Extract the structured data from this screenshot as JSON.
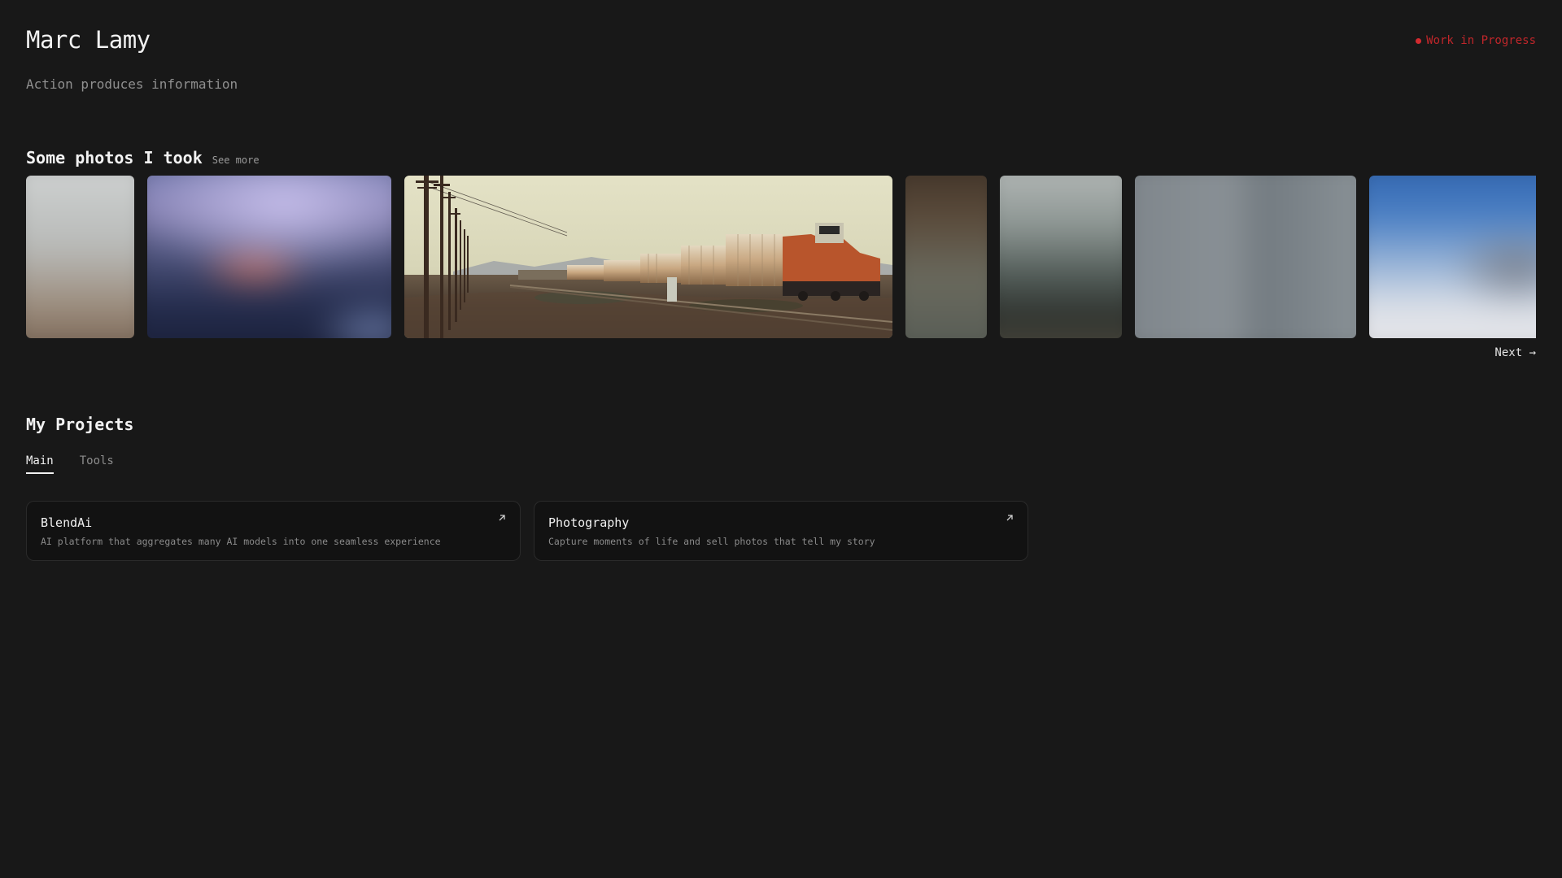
{
  "header": {
    "name": "Marc Lamy",
    "tagline": "Action produces information",
    "status": "Work in Progress",
    "status_color": "#d22a2f"
  },
  "photos": {
    "title": "Some photos I took",
    "see_more": "See more",
    "next": "Next →",
    "items": [
      {
        "name": "photo-blurred-1"
      },
      {
        "name": "photo-blurred-2"
      },
      {
        "name": "photo-train-desert"
      },
      {
        "name": "photo-blurred-4"
      },
      {
        "name": "photo-blurred-5"
      },
      {
        "name": "photo-blurred-6"
      },
      {
        "name": "photo-blurred-7"
      }
    ]
  },
  "projects": {
    "title": "My Projects",
    "tabs": [
      {
        "label": "Main",
        "active": true
      },
      {
        "label": "Tools",
        "active": false
      }
    ],
    "cards": [
      {
        "title": "BlendAi",
        "description": "AI platform that aggregates many AI models into one seamless experience",
        "icon": "external-link-icon"
      },
      {
        "title": "Photography",
        "description": "Capture moments of life and sell photos that tell my story",
        "icon": "external-link-icon"
      }
    ]
  }
}
